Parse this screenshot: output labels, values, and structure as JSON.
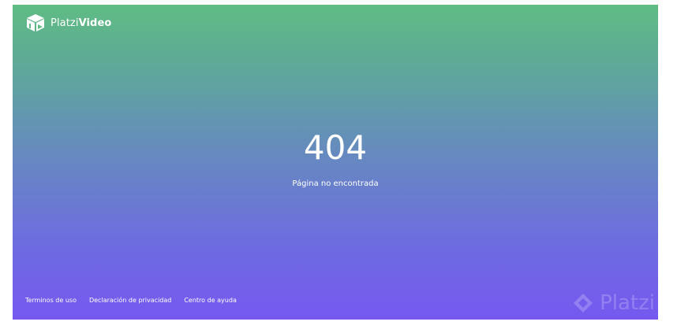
{
  "header": {
    "brand_part1": "Platzi",
    "brand_part2": "Video",
    "logo_icon": "cube-play-icon"
  },
  "error": {
    "code": "404",
    "message": "Página no encontrada"
  },
  "footer": {
    "links": [
      "Terminos de uso",
      "Declaración de privacidad",
      "Centro de ayuda"
    ]
  },
  "watermark": {
    "text": "Platzi",
    "icon": "platzi-diamond-icon"
  },
  "colors": {
    "gradient_top": "#5fbc83",
    "gradient_bottom": "#7658f0",
    "text": "#ffffff"
  }
}
